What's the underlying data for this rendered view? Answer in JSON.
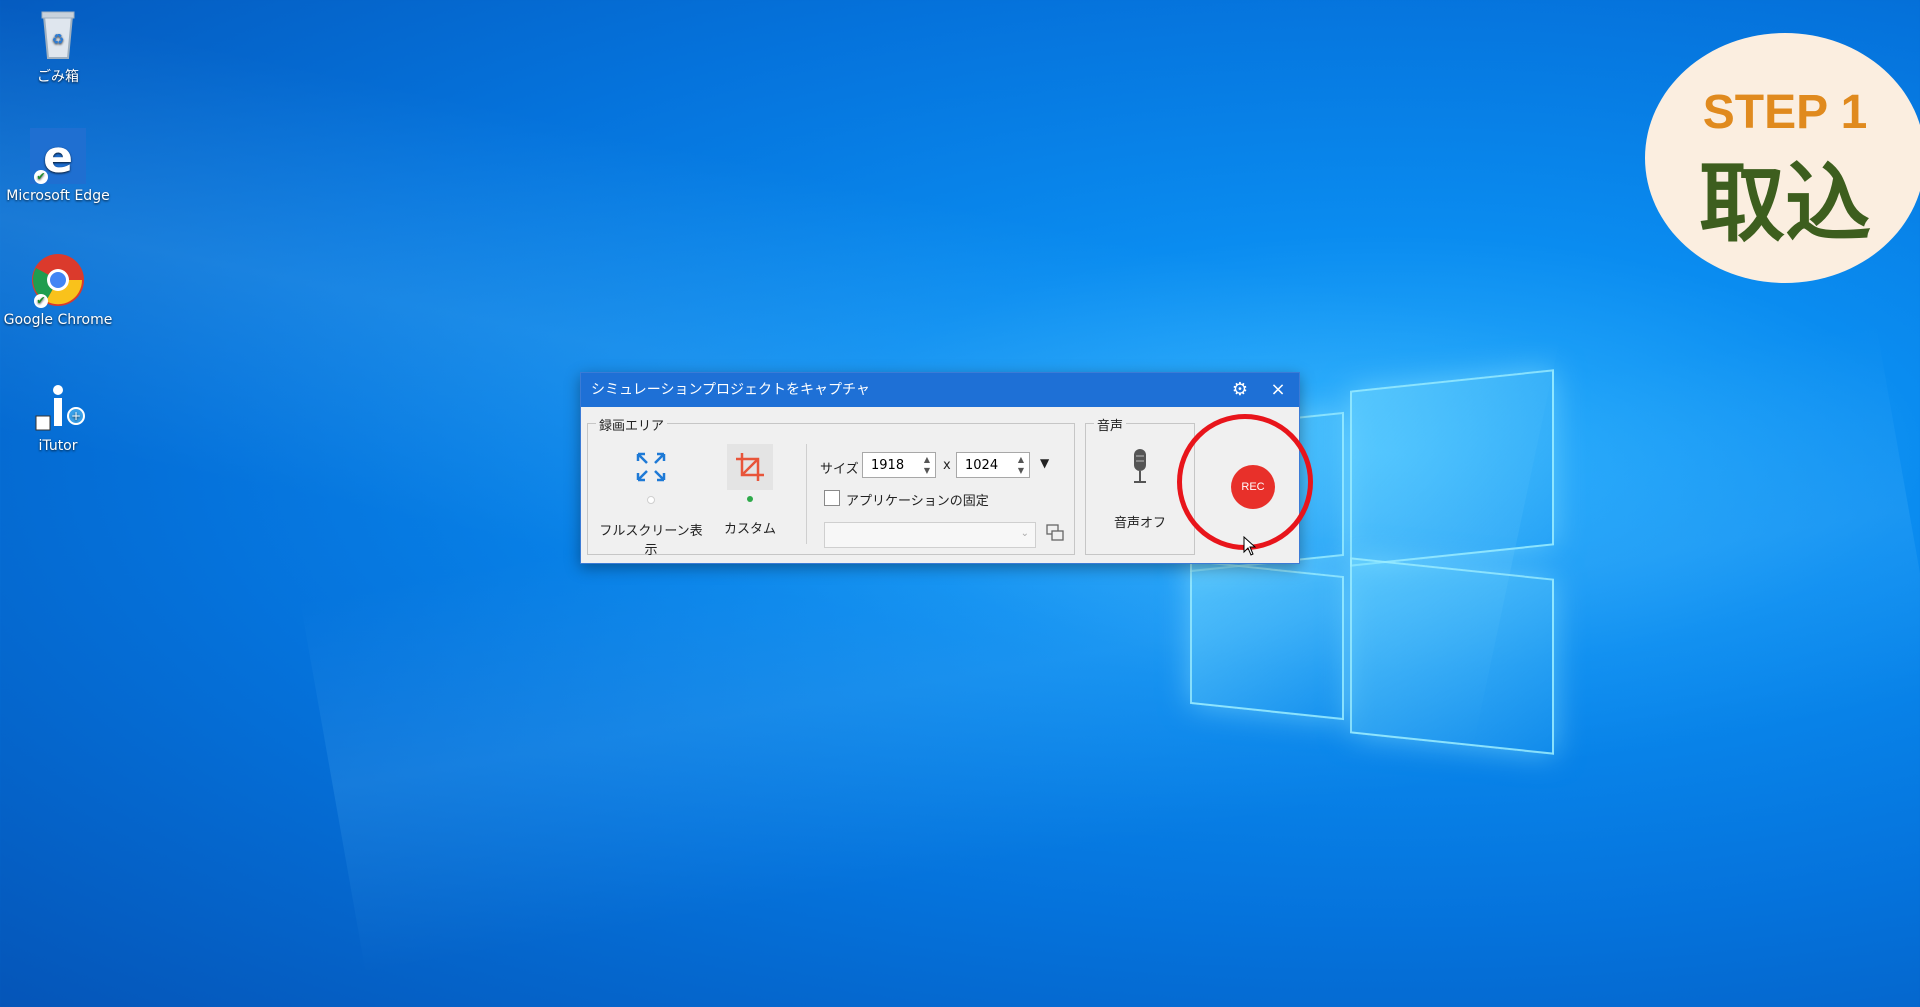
{
  "desktop": {
    "icons": [
      {
        "label": "ごみ箱",
        "icon": "recycle-bin-icon"
      },
      {
        "label": "Microsoft Edge",
        "icon": "edge-icon"
      },
      {
        "label": "Google Chrome",
        "icon": "chrome-icon"
      },
      {
        "label": "iTutor",
        "icon": "itutor-icon"
      }
    ]
  },
  "step_badge": {
    "line1": "STEP 1",
    "line2": "取込"
  },
  "dialog": {
    "title": "シミュレーションプロジェクトをキャプチャ",
    "settings_icon": "gear-icon",
    "close_label": "×",
    "record_area": {
      "label": "録画エリア",
      "fullscreen_label": "フルスクリーン表示",
      "custom_label": "カスタム"
    },
    "size": {
      "label": "サイズ",
      "width": "1918",
      "separator": "x",
      "height": "1024"
    },
    "app_lock_label": "アプリケーションの固定",
    "audio": {
      "label": "音声",
      "mic_label": "音声オフ"
    },
    "rec_label": "REC"
  },
  "colors": {
    "accent": "#1e70d6",
    "rec": "#e8302a",
    "highlight_ring": "#e8151b",
    "step_orange": "#e08a1e",
    "step_green": "#3d5e1e"
  }
}
